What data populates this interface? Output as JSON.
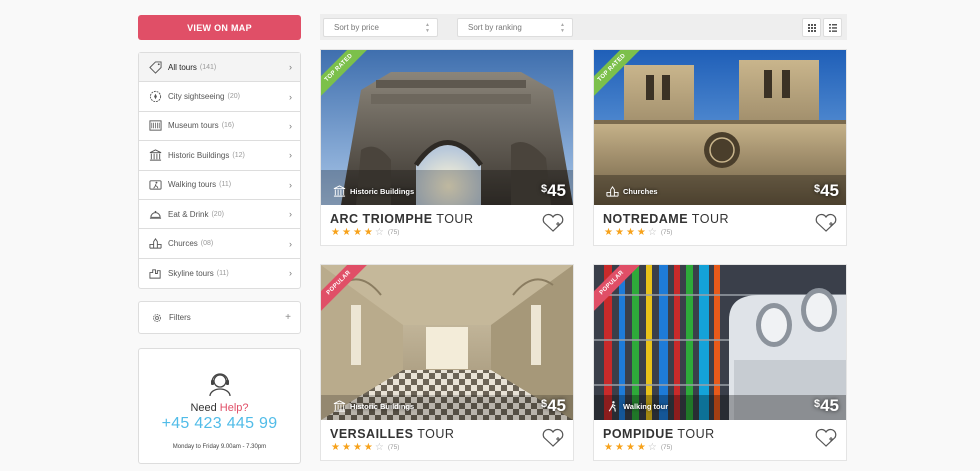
{
  "sidebar": {
    "map_button": "VIEW ON MAP",
    "categories": [
      {
        "label": "All tours",
        "count": "(141)",
        "icon": "tag-icon"
      },
      {
        "label": "City sightseeing",
        "count": "(20)",
        "icon": "compass-icon"
      },
      {
        "label": "Museum tours",
        "count": "(16)",
        "icon": "museum-icon"
      },
      {
        "label": "Historic Buildings",
        "count": "(12)",
        "icon": "historic-building-icon"
      },
      {
        "label": "Walking tours",
        "count": "(11)",
        "icon": "walking-icon"
      },
      {
        "label": "Eat & Drink",
        "count": "(20)",
        "icon": "food-cloche-icon"
      },
      {
        "label": "Churces",
        "count": "(08)",
        "icon": "church-icon"
      },
      {
        "label": "Skyline tours",
        "count": "(11)",
        "icon": "skyline-icon"
      }
    ],
    "filters_label": "Filters",
    "help": {
      "need": "Need",
      "help_word": "Help?",
      "phone": "+45 423 445 99",
      "hours": "Monday to Friday 9.00am - 7.30pm"
    }
  },
  "toolbar": {
    "sort_price": "Sort by price",
    "sort_ranking": "Sort by ranking",
    "grid_icon": "grid-view-icon",
    "list_icon": "list-view-icon"
  },
  "tours": [
    {
      "ribbon": "TOP RATED",
      "ribbon_color": "#7cc04b",
      "category": "Historic Buildings",
      "currency": "$",
      "price": "45",
      "name_bold": "ARC TRIOMPHE",
      "name_rest": " TOUR",
      "rating": 4,
      "reviews": "(75)"
    },
    {
      "ribbon": "TOP RATED",
      "ribbon_color": "#7cc04b",
      "category": "Churches",
      "currency": "$",
      "price": "45",
      "name_bold": "NOTREDAME",
      "name_rest": " TOUR",
      "rating": 4,
      "reviews": "(75)"
    },
    {
      "ribbon": "POPULAR",
      "ribbon_color": "#e04f67",
      "category": "Historic Buildings",
      "currency": "$",
      "price": "45",
      "name_bold": "VERSAILLES",
      "name_rest": " TOUR",
      "rating": 4,
      "reviews": "(75)"
    },
    {
      "ribbon": "POPULAR",
      "ribbon_color": "#e04f67",
      "category": "Walking tour",
      "currency": "$",
      "price": "45",
      "name_bold": "POMPIDUE",
      "name_rest": " TOUR",
      "rating": 4,
      "reviews": "(75)"
    }
  ],
  "colors": {
    "accent_red": "#e04f67",
    "phone_blue": "#51bce8",
    "star_orange": "#f7a21b",
    "ribbon_green": "#7cc04b"
  }
}
